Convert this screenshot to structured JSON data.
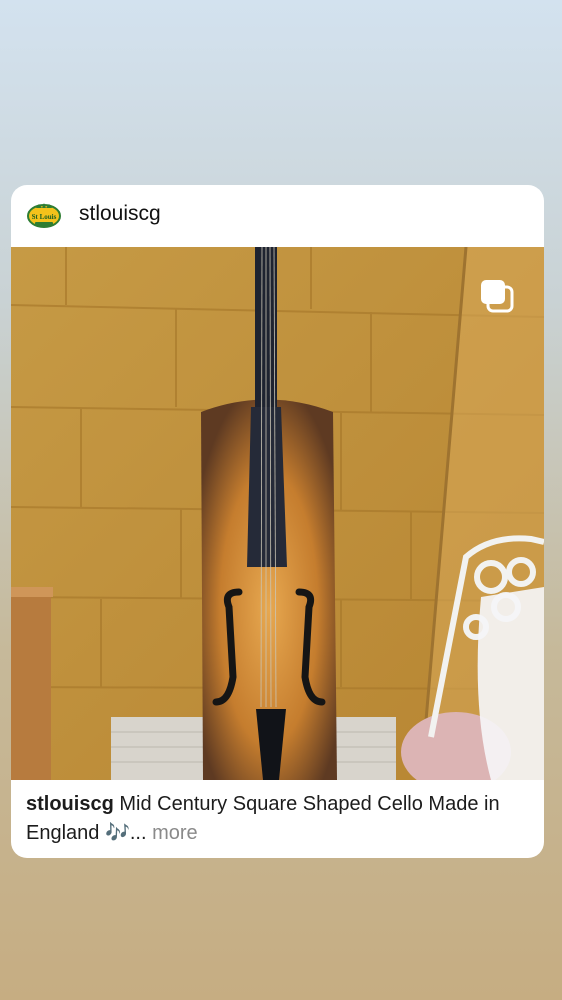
{
  "post": {
    "username": "stlouiscg",
    "avatar_text": "St Louis",
    "caption_user": "stlouiscg",
    "caption_text": "Mid Century Square Shaped Cello Made in England 🎶",
    "ellipsis": "...",
    "more_label": "more"
  },
  "icons": {
    "multi_photo": "carousel-stack-icon"
  },
  "colors": {
    "card_background": "#ffffff",
    "wall": "#c1913a",
    "more_text": "#8a8a8a"
  }
}
